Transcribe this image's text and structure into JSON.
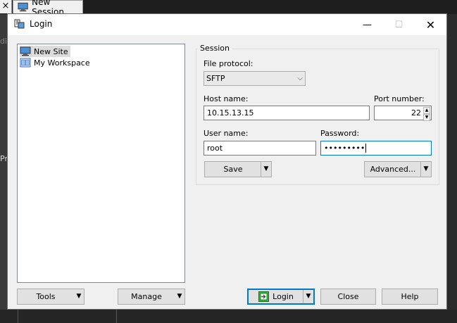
{
  "background": {
    "tab_close": "×",
    "tab_title": "New Session",
    "side_text_1": "di",
    "side_text_2": "Pre"
  },
  "window": {
    "title": "Login",
    "minimize": "—",
    "maximize": "☐",
    "close": "✕"
  },
  "site_tree": {
    "items": [
      {
        "label": "New Site",
        "icon": "monitor-icon",
        "selected": true
      },
      {
        "label": "My Workspace",
        "icon": "workspace-icon",
        "selected": false
      }
    ]
  },
  "session": {
    "group_label": "Session",
    "file_protocol_label": "File protocol:",
    "file_protocol_value": "SFTP",
    "host_label": "Host name:",
    "host_value": "10.15.13.15",
    "port_label": "Port number:",
    "port_value": "22",
    "user_label": "User name:",
    "user_value": "root",
    "password_label": "Password:",
    "password_value": "•••••••••",
    "save_label": "Save",
    "advanced_label": "Advanced..."
  },
  "footer": {
    "tools_label": "Tools",
    "manage_label": "Manage",
    "login_label": "Login",
    "close_label": "Close",
    "help_label": "Help"
  },
  "colors": {
    "accent": "#0078d7",
    "dialog_bg": "#f0f0f0"
  }
}
